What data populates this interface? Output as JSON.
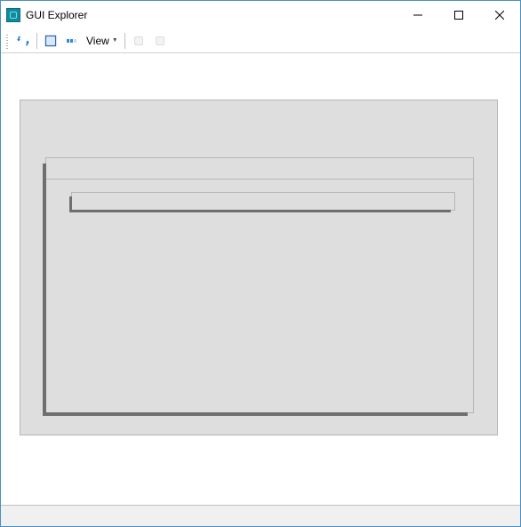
{
  "window": {
    "title": "GUI Explorer"
  },
  "toolbar": {
    "refresh_tt": "Refresh",
    "outline_tt": "Outline",
    "highlight_tt": "Highlight",
    "view_label": "View",
    "step_tt": "Step",
    "stop_tt": "Stop"
  }
}
